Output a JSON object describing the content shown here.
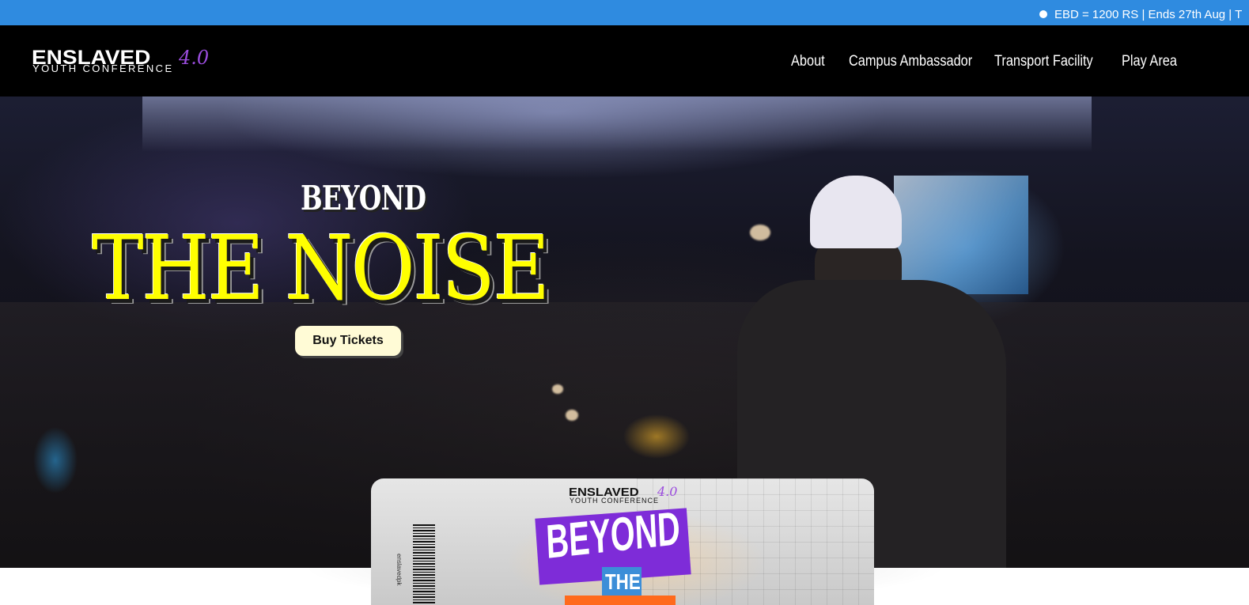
{
  "ticker": {
    "text": "EBD = 1200 RS | Ends 27th Aug | T"
  },
  "logo": {
    "main": "ENSLAVED",
    "version": "4.0",
    "subtitle": "YOUTH CONFERENCE"
  },
  "nav": {
    "items": [
      {
        "label": "About"
      },
      {
        "label": "Campus Ambassador"
      },
      {
        "label": "Transport Facility"
      },
      {
        "label": "Play Area"
      }
    ]
  },
  "hero": {
    "title_top": "BEYOND",
    "title_main": "THE NOISE",
    "cta_label": "Buy Tickets"
  },
  "ticket": {
    "logo_main": "ENSLAVED",
    "logo_version": "4.0",
    "logo_subtitle": "YOUTH CONFERENCE",
    "badge_text": "BEYOND",
    "badge_the": "THE",
    "barcode_label": "enslavedpk"
  },
  "colors": {
    "ticker_bg": "#2f8be0",
    "nav_bg": "#000000",
    "accent_purple": "#9b4dde",
    "title_yellow": "#ffff00",
    "button_bg": "#fffbd6"
  }
}
